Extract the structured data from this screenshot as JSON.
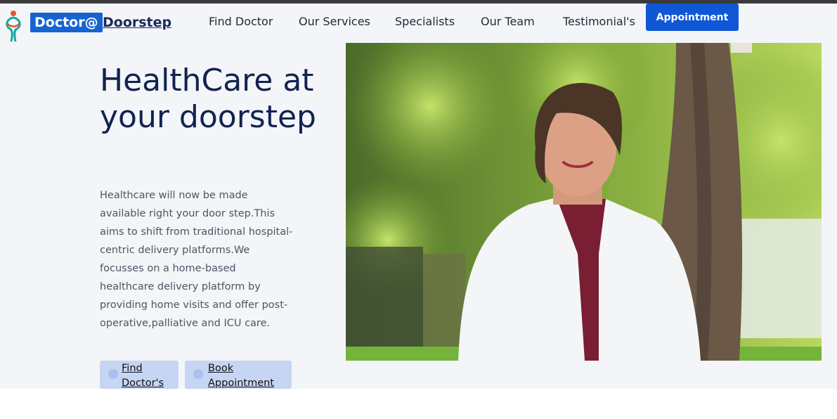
{
  "brand": {
    "box_text": "Doctor@",
    "text": "Doorstep"
  },
  "nav": {
    "items": [
      {
        "label": "Find Doctor"
      },
      {
        "label": "Our Services"
      },
      {
        "label": "Specialists"
      },
      {
        "label": "Our Team"
      },
      {
        "label": "Testimonial's"
      }
    ],
    "appointment_label": "Appointment"
  },
  "hero": {
    "headline": "HealthCare at your doorstep",
    "description": "Healthcare will now be made available right your door step.This aims to shift from traditional hospital-centric delivery platforms.We focusses on a home-based healthcare delivery platform by providing home visits and offer post-operative,palliative and ICU care.",
    "find_doctor_label": "Find Doctor's",
    "book_appointment_label": "Book Appointment"
  },
  "colors": {
    "accent": "#1057d6",
    "headline": "#122350",
    "hero_bg": "#f3f5f8",
    "cta_bg": "#c6d5f3"
  }
}
